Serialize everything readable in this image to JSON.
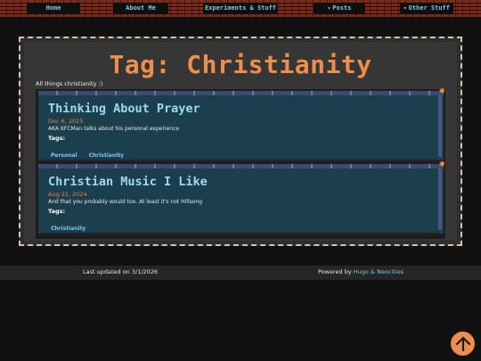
{
  "nav": {
    "items": [
      {
        "label": "Home",
        "dropdown": false
      },
      {
        "label": "About Me",
        "dropdown": false
      },
      {
        "label": "Experiments & Stuff",
        "dropdown": false
      },
      {
        "label": "Posts",
        "dropdown": true
      },
      {
        "label": "Other Stuff",
        "dropdown": true
      }
    ],
    "caret": "▾"
  },
  "page": {
    "title": "Tag: Christianity",
    "subtitle": "All things christianity :)"
  },
  "posts": [
    {
      "title": "Thinking About Prayer",
      "date": "Dec 6, 2025",
      "description": "AKA KFCMan talks about his personal experience",
      "tags_label": "Tags:",
      "tags": [
        "Personal",
        "Christianity"
      ]
    },
    {
      "title": "Christian Music I Like",
      "date": "Aug 21, 2024",
      "description": "And that you probably would too. At least it's not Hillsong",
      "tags_label": "Tags:",
      "tags": [
        "Christianity"
      ]
    }
  ],
  "footer": {
    "updated": "Last updated on 3/1/2026",
    "powered_prefix": "Powered by",
    "hugo": "Hugo",
    "amp": "&",
    "neocities": "Neocities"
  },
  "colors": {
    "accent": "#ef8d4c",
    "link": "#7fc6ea",
    "card_bg": "#1b3f4c",
    "background": "#111111"
  },
  "icons": {
    "scroll_top": "arrow-up-icon",
    "card_corner": "gear-bolt-icon"
  }
}
